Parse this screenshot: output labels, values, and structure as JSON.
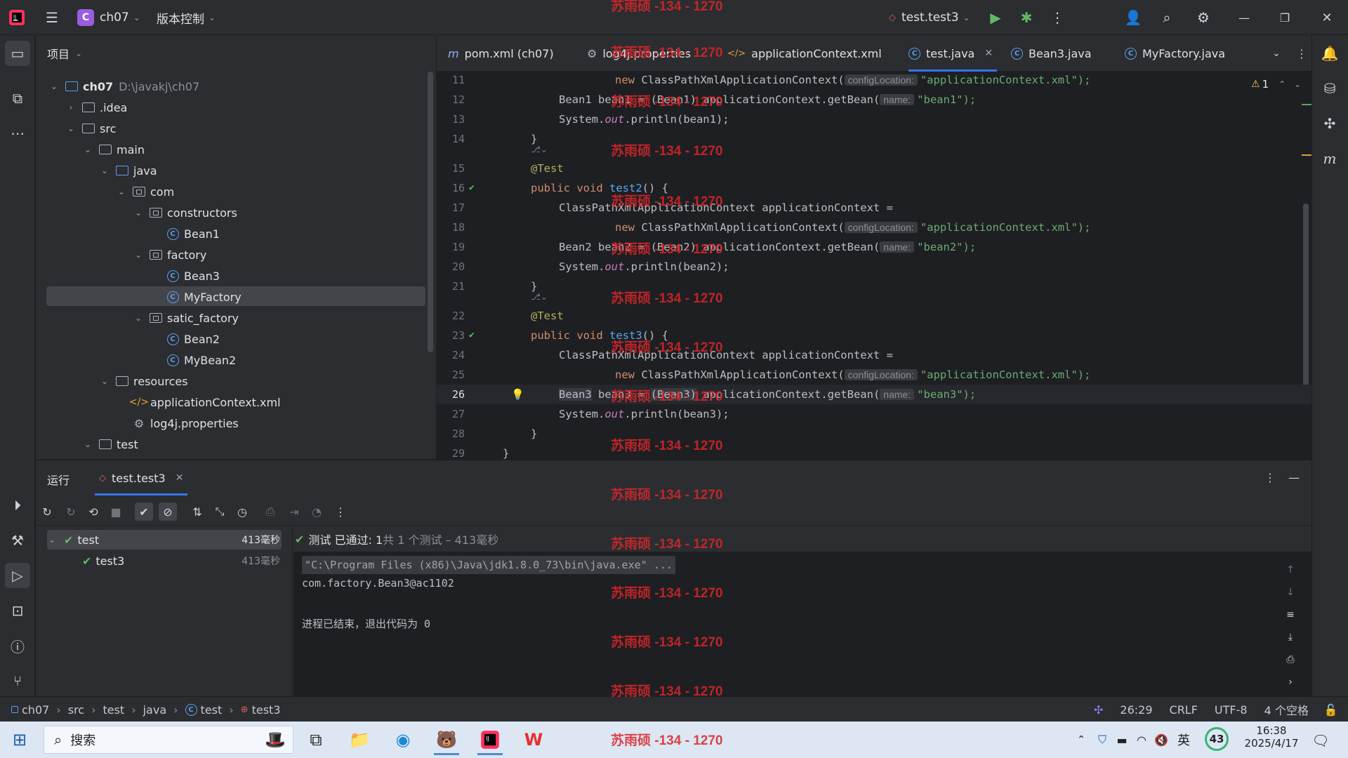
{
  "titlebar": {
    "project_badge": "C",
    "project_name": "ch07",
    "vcs_menu": "版本控制",
    "run_config": "test.test3"
  },
  "project_panel": {
    "title": "项目",
    "root_name": "ch07",
    "root_path": "D:\\javakj\\ch07",
    "items": [
      {
        "label": "ch07"
      },
      {
        "label": ".idea"
      },
      {
        "label": "src"
      },
      {
        "label": "main"
      },
      {
        "label": "java"
      },
      {
        "label": "com"
      },
      {
        "label": "constructors"
      },
      {
        "label": "Bean1"
      },
      {
        "label": "factory"
      },
      {
        "label": "Bean3"
      },
      {
        "label": "MyFactory"
      },
      {
        "label": "satic_factory"
      },
      {
        "label": "Bean2"
      },
      {
        "label": "MyBean2"
      },
      {
        "label": "resources"
      },
      {
        "label": "applicationContext.xml"
      },
      {
        "label": "log4j.properties"
      },
      {
        "label": "test"
      }
    ]
  },
  "editor": {
    "tabs": [
      {
        "label": "pom.xml (ch07)"
      },
      {
        "label": "log4j.properties"
      },
      {
        "label": "applicationContext.xml"
      },
      {
        "label": "test.java"
      },
      {
        "label": "Bean3.java"
      },
      {
        "label": "MyFactory.java"
      }
    ],
    "warning_count": "1",
    "line_numbers": [
      "11",
      "12",
      "13",
      "14",
      "15",
      "16",
      "17",
      "18",
      "19",
      "20",
      "21",
      "22",
      "23",
      "24",
      "25",
      "26",
      "27",
      "28",
      "29"
    ],
    "code": {
      "new_kw": "new",
      "ctx_class": "ClassPathXmlApplicationContext(",
      "hint_config": "configLocation:",
      "hint_name": "name:",
      "xml_str": "\"applicationContext.xml\");",
      "l12_a": "Bean1 bean1 = (Bean1) applicationContext.getBean(",
      "l12_s": "\"bean1\");",
      "println_a": "System.",
      "out": "out",
      "l13_b": ".println(bean1);",
      "brace_close": "}",
      "annotation": "@Test",
      "public_void": "public void",
      "test2": "test2",
      "test3": "test3",
      "sig_end": "() {",
      "ctx_decl": "ClassPathXmlApplicationContext applicationContext =",
      "l19_a": "Bean2 bean2 = (Bean2) applicationContext.getBean(",
      "l19_s": "\"bean2\");",
      "l20_b": ".println(bean2);",
      "l26_t1": "Bean3",
      "l26_m": " bean3 = ",
      "l26_t2": "(Bean3)",
      "l26_e": " applicationContext.getBean(",
      "l26_s": "\"bean3\");",
      "l27_b": ".println(bean3);"
    }
  },
  "run_panel": {
    "title": "运行",
    "tab": "test.test3",
    "tree": [
      {
        "label": "test",
        "time": "413毫秒"
      },
      {
        "label": "test3",
        "time": "413毫秒"
      }
    ],
    "summary_passed": "测试 已通过: 1",
    "summary_rest": "共 1 个测试 – 413毫秒",
    "console": [
      "\"C:\\Program Files (x86)\\Java\\jdk1.8.0_73\\bin\\java.exe\" ...",
      "com.factory.Bean3@ac1102",
      "进程已结束，退出代码为 0"
    ]
  },
  "statusbar": {
    "breadcrumb": [
      "ch07",
      "src",
      "test",
      "java",
      "test",
      "test3"
    ],
    "position": "26:29",
    "line_sep": "CRLF",
    "encoding": "UTF-8",
    "indent": "4 个空格"
  },
  "taskbar": {
    "search": "搜索",
    "ime": "英",
    "badge": "43",
    "time": "16:38",
    "date": "2025/4/17"
  },
  "watermark": "苏雨硕 -134 - 1270"
}
